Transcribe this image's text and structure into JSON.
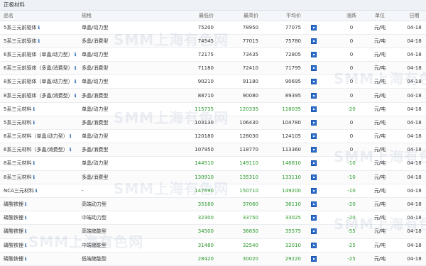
{
  "section_title": "正极材料",
  "headers": {
    "name": "品名",
    "spec": "规格",
    "min_price": "最低价",
    "max_price": "最高价",
    "avg_price": "平均价",
    "change": "涨跌",
    "unit": "单位",
    "date": "日期"
  },
  "colors": {
    "up_green": "#2a9a2a",
    "icon_blue": "#2d6fd0"
  },
  "icons": {
    "info": "ℹ",
    "chart": "chart-icon"
  },
  "watermark_text": "SMM上海有色网",
  "rows": [
    {
      "name": "5系三元前驱体",
      "info": true,
      "spec": "单晶/动力型",
      "min": "75200",
      "max": "78950",
      "avg": "77075",
      "change": "0",
      "unit": "元/吨",
      "date": "04-18",
      "green": false
    },
    {
      "name": "5系三元前驱体",
      "info": true,
      "spec": "多晶/消费型",
      "min": "74545",
      "max": "77015",
      "avg": "75780",
      "change": "0",
      "unit": "元/吨",
      "date": "04-18",
      "green": false
    },
    {
      "name": "6系三元前驱体（单晶/动力型）",
      "info": true,
      "spec": "单晶/动力型",
      "min": "72175",
      "max": "73435",
      "avg": "72805",
      "change": "0",
      "unit": "元/吨",
      "date": "04-18",
      "green": false
    },
    {
      "name": "6系三元前驱体（多晶/消费型）",
      "info": true,
      "spec": "多晶/消费型",
      "min": "71180",
      "max": "72410",
      "avg": "71795",
      "change": "0",
      "unit": "元/吨",
      "date": "04-18",
      "green": false
    },
    {
      "name": "8系三元前驱体（单晶/动力型）",
      "info": true,
      "spec": "单晶/动力型",
      "min": "90210",
      "max": "91180",
      "avg": "90695",
      "change": "0",
      "unit": "元/吨",
      "date": "04-18",
      "green": false
    },
    {
      "name": "8系三元前驱体（多晶/消费型）",
      "info": true,
      "spec": "多晶/消费型",
      "min": "88710",
      "max": "90080",
      "avg": "89395",
      "change": "0",
      "unit": "元/吨",
      "date": "04-18",
      "green": false
    },
    {
      "name": "5系三元材料",
      "info": true,
      "spec": "单晶/动力型",
      "min": "115735",
      "max": "120335",
      "avg": "118035",
      "change": "-20",
      "unit": "元/吨",
      "date": "04-18",
      "green": true
    },
    {
      "name": "5系三元材料",
      "info": true,
      "spec": "多晶/消费型",
      "min": "103130",
      "max": "106430",
      "avg": "104780",
      "change": "0",
      "unit": "元/吨",
      "date": "04-18",
      "green": false
    },
    {
      "name": "6系三元材料（单晶/动力型）",
      "info": true,
      "spec": "单晶/动力型",
      "min": "120180",
      "max": "128030",
      "avg": "124105",
      "change": "0",
      "unit": "元/吨",
      "date": "04-18",
      "green": false
    },
    {
      "name": "6系三元材料（多晶/消费型）",
      "info": true,
      "spec": "多晶/消费型",
      "min": "107950",
      "max": "118770",
      "avg": "113360",
      "change": "0",
      "unit": "元/吨",
      "date": "04-18",
      "green": false
    },
    {
      "name": "8系三元材料",
      "info": true,
      "spec": "单晶/动力型",
      "min": "144510",
      "max": "149110",
      "avg": "146810",
      "change": "-10",
      "unit": "元/吨",
      "date": "04-18",
      "green": true
    },
    {
      "name": "8系三元材料",
      "info": true,
      "spec": "多晶/消费型",
      "min": "130910",
      "max": "135310",
      "avg": "133110",
      "change": "-10",
      "unit": "元/吨",
      "date": "04-18",
      "green": true
    },
    {
      "name": "NCA三元材料",
      "info": true,
      "spec": "-",
      "min": "147690",
      "max": "150710",
      "avg": "149200",
      "change": "-10",
      "unit": "元/吨",
      "date": "04-18",
      "green": true
    },
    {
      "name": "磷酸铁锂",
      "info": true,
      "spec": "高端动力型",
      "min": "35160",
      "max": "37060",
      "avg": "36110",
      "change": "-20",
      "unit": "元/吨",
      "date": "04-18",
      "green": true
    },
    {
      "name": "磷酸铁锂",
      "info": true,
      "spec": "中端动力型",
      "min": "32300",
      "max": "33750",
      "avg": "33025",
      "change": "-20",
      "unit": "元/吨",
      "date": "04-18",
      "green": true
    },
    {
      "name": "磷酸铁锂",
      "info": true,
      "spec": "高端储能型",
      "min": "34500",
      "max": "36650",
      "avg": "35575",
      "change": "-55",
      "unit": "元/吨",
      "date": "04-18",
      "green": true
    },
    {
      "name": "磷酸铁锂",
      "info": true,
      "spec": "中端储能型",
      "min": "31480",
      "max": "32540",
      "avg": "32010",
      "change": "-25",
      "unit": "元/吨",
      "date": "04-18",
      "green": true
    },
    {
      "name": "磷酸铁锂",
      "info": true,
      "spec": "低端储能型",
      "min": "28420",
      "max": "30020",
      "avg": "29220",
      "change": "-25",
      "unit": "元/吨",
      "date": "04-18",
      "green": true
    }
  ]
}
